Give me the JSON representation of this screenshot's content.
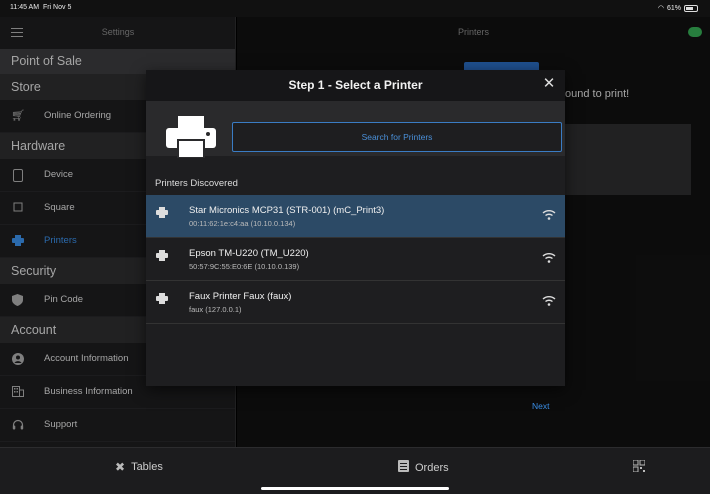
{
  "status_bar": {
    "time": "11:45 AM",
    "date": "Fri Nov 5",
    "battery": "61%"
  },
  "sidebar": {
    "title": "Settings",
    "pos_header": "Point of Sale",
    "sections": [
      {
        "header": "Store",
        "items": [
          {
            "label": "Online Ordering",
            "icon": "cart-icon"
          }
        ]
      },
      {
        "header": "Hardware",
        "items": [
          {
            "label": "Device",
            "icon": "tablet-icon"
          },
          {
            "label": "Square",
            "icon": "square-icon"
          },
          {
            "label": "Printers",
            "icon": "printer-icon",
            "active": true
          }
        ]
      },
      {
        "header": "Security",
        "items": [
          {
            "label": "Pin Code",
            "icon": "shield-icon"
          }
        ]
      },
      {
        "header": "Account",
        "items": [
          {
            "label": "Account Information",
            "icon": "person-icon"
          },
          {
            "label": "Business Information",
            "icon": "building-icon"
          },
          {
            "label": "Support",
            "icon": "headset-icon"
          }
        ]
      }
    ]
  },
  "main": {
    "title": "Printers",
    "background_text": "ound to print!"
  },
  "modal": {
    "title": "Step 1 - Select a Printer",
    "search_placeholder": "Search for Printers",
    "discovered_label": "Printers Discovered",
    "printers": [
      {
        "name": "Star Micronics MCP31 (STR-001) (mC_Print3)",
        "address": "00:11:62:1e:c4:aa (10.10.0.134)",
        "selected": true
      },
      {
        "name": "Epson TM-U220 (TM_U220)",
        "address": "50:57:9C:55:E0:6E (10.10.0.139)",
        "selected": false
      },
      {
        "name": "Faux Printer Faux (faux)",
        "address": "faux (127.0.0.1)",
        "selected": false
      }
    ],
    "next_label": "Next"
  },
  "tab_bar": {
    "tables_label": "Tables",
    "orders_label": "Orders"
  },
  "colors": {
    "accent": "#3a8ee6",
    "selected_row": "#2c4a66",
    "cloud": "#34a853"
  }
}
